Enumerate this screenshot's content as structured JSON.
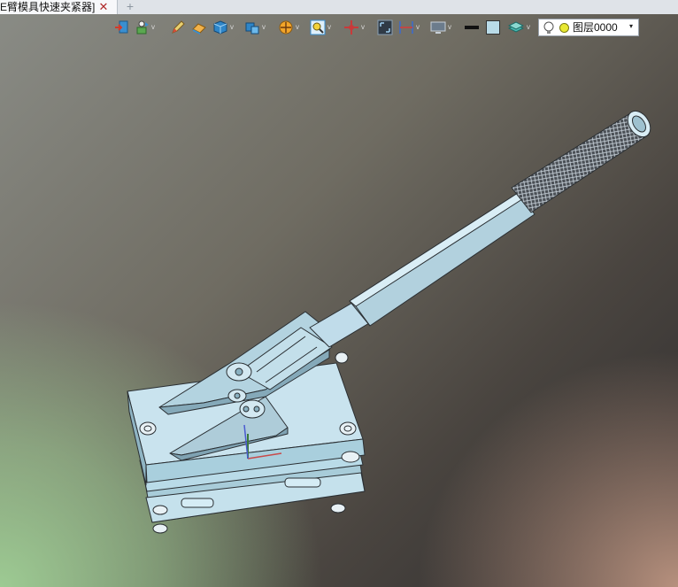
{
  "tab": {
    "title": "E臂模具快速夹紧器]",
    "close_glyph": "✕",
    "add_glyph": "+"
  },
  "toolbar": {
    "tools": [
      {
        "icon": "exit-icon",
        "has_dropdown": false
      },
      {
        "icon": "rotate-view-icon",
        "has_dropdown": true
      },
      {
        "icon": "pencil-icon",
        "has_dropdown": false
      },
      {
        "icon": "eraser-icon",
        "has_dropdown": false
      },
      {
        "icon": "solid-cube-icon",
        "has_dropdown": true
      },
      {
        "icon": "view-orientation-icon",
        "has_dropdown": true
      },
      {
        "icon": "section-view-icon",
        "has_dropdown": true
      },
      {
        "icon": "zoom-icon",
        "has_dropdown": true
      },
      {
        "icon": "pan-icon",
        "has_dropdown": true
      },
      {
        "icon": "fit-view-icon",
        "has_dropdown": false
      },
      {
        "icon": "dimension-icon",
        "has_dropdown": true
      },
      {
        "icon": "display-monitor-icon",
        "has_dropdown": true
      },
      {
        "icon": "line-color-icon",
        "has_dropdown": false
      },
      {
        "icon": "fill-color-icon",
        "has_dropdown": false
      },
      {
        "icon": "layer-stack-icon",
        "has_dropdown": true
      }
    ],
    "dropdown_glyph": "v"
  },
  "layer": {
    "name": "图层0000",
    "arrow": "▾",
    "bulb_icon": "lightbulb-icon",
    "color_icon": "layer-color-icon",
    "dot_color": "#e8e832"
  },
  "colors": {
    "part_fill": "#b9dbe8",
    "part_outline": "#2a2f33",
    "grip": "#3a3f44"
  }
}
